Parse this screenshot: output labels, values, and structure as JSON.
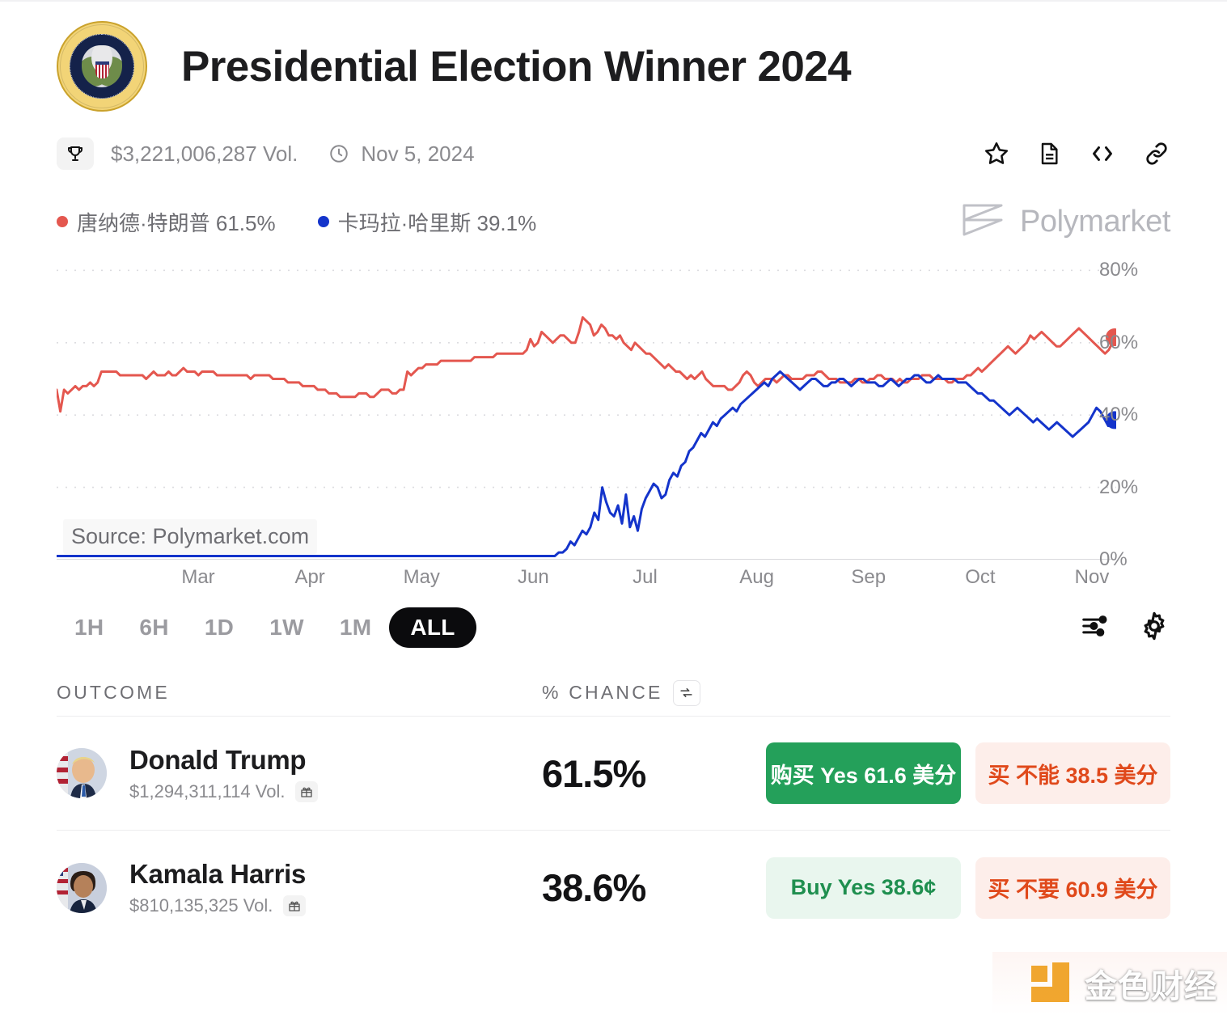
{
  "header": {
    "title": "Presidential Election Winner 2024",
    "seal_icon": "presidential-seal-icon",
    "trophy_icon": "trophy-icon",
    "volume": "$3,221,006,287 Vol.",
    "clock_icon": "clock-icon",
    "date": "Nov 5, 2024",
    "icons": [
      {
        "name": "star-icon",
        "label": "star"
      },
      {
        "name": "document-icon",
        "label": "rules"
      },
      {
        "name": "code-icon",
        "label": "embed"
      },
      {
        "name": "link-icon",
        "label": "copy link"
      }
    ]
  },
  "legend": {
    "items": [
      {
        "label": "唐纳德·特朗普 61.5%",
        "color": "#e4574f"
      },
      {
        "label": "卡玛拉·哈里斯 39.1%",
        "color": "#1434cb"
      }
    ],
    "brand": "Polymarket",
    "brand_icon": "polymarket-logo-icon"
  },
  "chart_data": {
    "type": "line",
    "title": "Presidential Election Winner 2024",
    "xlabel": "",
    "ylabel": "",
    "ylim": [
      0,
      85
    ],
    "y_ticks": [
      "0%",
      "20%",
      "40%",
      "60%",
      "80%"
    ],
    "y_tick_values": [
      0,
      20,
      40,
      60,
      80
    ],
    "x_ticks": [
      "Mar",
      "Apr",
      "May",
      "Jun",
      "Jul",
      "Aug",
      "Sep",
      "Oct",
      "Nov"
    ],
    "grid": true,
    "legend_position": "top-left",
    "source_note": "Source: Polymarket.com",
    "series": [
      {
        "name": "唐纳德·特朗普",
        "color": "#e4574f",
        "end_value": 61.5,
        "end_label": "61.5%",
        "values": [
          47,
          41,
          47,
          46,
          47,
          48,
          47,
          48,
          48,
          49,
          48,
          49,
          52,
          52,
          52,
          52,
          52,
          51,
          51,
          51,
          51,
          51,
          51,
          51,
          50,
          51,
          52,
          51,
          51,
          51,
          52,
          51,
          51,
          52,
          53,
          52,
          52,
          52,
          51,
          52,
          52,
          52,
          52,
          51,
          51,
          51,
          51,
          51,
          51,
          51,
          51,
          51,
          50,
          51,
          51,
          51,
          51,
          51,
          50,
          50,
          50,
          50,
          49,
          49,
          49,
          49,
          48,
          48,
          48,
          48,
          47,
          47,
          47,
          46,
          46,
          46,
          45,
          45,
          45,
          45,
          45,
          46,
          46,
          46,
          45,
          45,
          46,
          47,
          47,
          47,
          46,
          46,
          47,
          47,
          52,
          51,
          52,
          53,
          53,
          54,
          54,
          54,
          54,
          55,
          55,
          55,
          55,
          55,
          55,
          55,
          55,
          55,
          56,
          56,
          56,
          56,
          56,
          56,
          57,
          57,
          57,
          57,
          57,
          57,
          57,
          57,
          58,
          61,
          59,
          60,
          63,
          62,
          61,
          60,
          61,
          62,
          62,
          61,
          60,
          60,
          63,
          67,
          66,
          65,
          62,
          63,
          65,
          64,
          62,
          62,
          61,
          62,
          60,
          59,
          58,
          60,
          59,
          58,
          57,
          57,
          56,
          55,
          54,
          53,
          54,
          53,
          52,
          52,
          51,
          50,
          51,
          50,
          51,
          52,
          50,
          49,
          48,
          48,
          48,
          48,
          47,
          47,
          48,
          49,
          51,
          52,
          51,
          49,
          48,
          49,
          50,
          50,
          50,
          49,
          50,
          51,
          51,
          50,
          50,
          50,
          50,
          51,
          51,
          51,
          52,
          52,
          51,
          50,
          50,
          50,
          49,
          49,
          49,
          49,
          50,
          50,
          49,
          49,
          50,
          50,
          51,
          51,
          50,
          50,
          50,
          49,
          50,
          49,
          49,
          50,
          50,
          50,
          51,
          51,
          51,
          50,
          50,
          50,
          50,
          49,
          49,
          50,
          50,
          50,
          51,
          51,
          52,
          53,
          52,
          53,
          54,
          55,
          56,
          57,
          58,
          59,
          58,
          57,
          58,
          59,
          60,
          62,
          61,
          62,
          63,
          62,
          61,
          60,
          59,
          59,
          60,
          61,
          62,
          63,
          64,
          63,
          62,
          61,
          60,
          59,
          58,
          57,
          58,
          60,
          61.5
        ]
      },
      {
        "name": "卡玛拉·哈里斯",
        "color": "#1434cb",
        "end_value": 38.6,
        "end_label": "38.6%",
        "values": [
          1,
          1,
          1,
          1,
          1,
          1,
          1,
          1,
          1,
          1,
          1,
          1,
          1,
          1,
          1,
          1,
          1,
          1,
          1,
          1,
          1,
          1,
          1,
          1,
          1,
          1,
          1,
          1,
          1,
          1,
          1,
          1,
          1,
          1,
          1,
          1,
          1,
          1,
          1,
          1,
          1,
          1,
          1,
          1,
          1,
          1,
          1,
          1,
          1,
          1,
          1,
          1,
          1,
          1,
          1,
          1,
          1,
          1,
          1,
          1,
          1,
          1,
          1,
          1,
          1,
          1,
          1,
          1,
          1,
          1,
          1,
          1,
          1,
          1,
          1,
          1,
          1,
          1,
          1,
          1,
          1,
          1,
          1,
          1,
          1,
          1,
          1,
          1,
          1,
          1,
          1,
          1,
          1,
          1,
          1,
          1,
          1,
          1,
          1,
          1,
          1,
          1,
          1,
          1,
          1,
          1,
          1,
          1,
          1,
          1,
          1,
          1,
          1,
          1,
          1,
          1,
          1,
          1,
          1,
          1,
          1,
          1,
          1,
          1,
          1,
          1,
          1,
          2,
          2,
          3,
          5,
          4,
          6,
          8,
          7,
          9,
          13,
          11,
          20,
          16,
          13,
          12,
          15,
          10,
          18,
          9,
          12,
          8,
          14,
          17,
          19,
          21,
          20,
          17,
          18,
          22,
          24,
          23,
          26,
          27,
          30,
          31,
          33,
          35,
          34,
          36,
          38,
          37,
          39,
          40,
          41,
          42,
          41,
          43,
          44,
          45,
          46,
          47,
          48,
          49,
          48,
          50,
          51,
          52,
          51,
          50,
          49,
          48,
          47,
          48,
          49,
          50,
          50,
          49,
          48,
          48,
          49,
          49,
          50,
          50,
          49,
          48,
          49,
          50,
          50,
          49,
          49,
          49,
          48,
          48,
          49,
          50,
          49,
          48,
          49,
          50,
          50,
          51,
          51,
          50,
          49,
          49,
          50,
          51,
          50,
          50,
          50,
          50,
          49,
          49,
          49,
          48,
          47,
          46,
          46,
          45,
          44,
          44,
          43,
          42,
          41,
          40,
          41,
          42,
          41,
          40,
          39,
          38,
          39,
          38,
          37,
          36,
          37,
          38,
          37,
          36,
          35,
          34,
          35,
          36,
          37,
          38,
          40,
          42,
          41,
          39,
          37,
          38,
          38.6
        ]
      }
    ]
  },
  "range": {
    "options": [
      "1H",
      "6H",
      "1D",
      "1W",
      "1M",
      "ALL"
    ],
    "active": "ALL",
    "filter_icon": "sliders-icon",
    "settings_icon": "gear-icon"
  },
  "table": {
    "headers": {
      "outcome": "OUTCOME",
      "chance": "% CHANCE",
      "swap_icon": "refresh-icon"
    },
    "rows": [
      {
        "name": "Donald Trump",
        "volume": "$1,294,311,114 Vol.",
        "gift_icon": "gift-icon",
        "chance": "61.5%",
        "buy_yes": "购买 Yes 61.6 美分",
        "buy_no": "买 不能 38.5 美分",
        "yes_style": "solid"
      },
      {
        "name": "Kamala Harris",
        "volume": "$810,135,325 Vol.",
        "gift_icon": "gift-icon",
        "chance": "38.6%",
        "buy_yes": "Buy Yes 38.6¢",
        "buy_no": "买 不要 60.9 美分",
        "yes_style": "soft"
      }
    ]
  },
  "watermark": {
    "text": "金色财经",
    "mark_icon": "jinse-logo-icon"
  }
}
